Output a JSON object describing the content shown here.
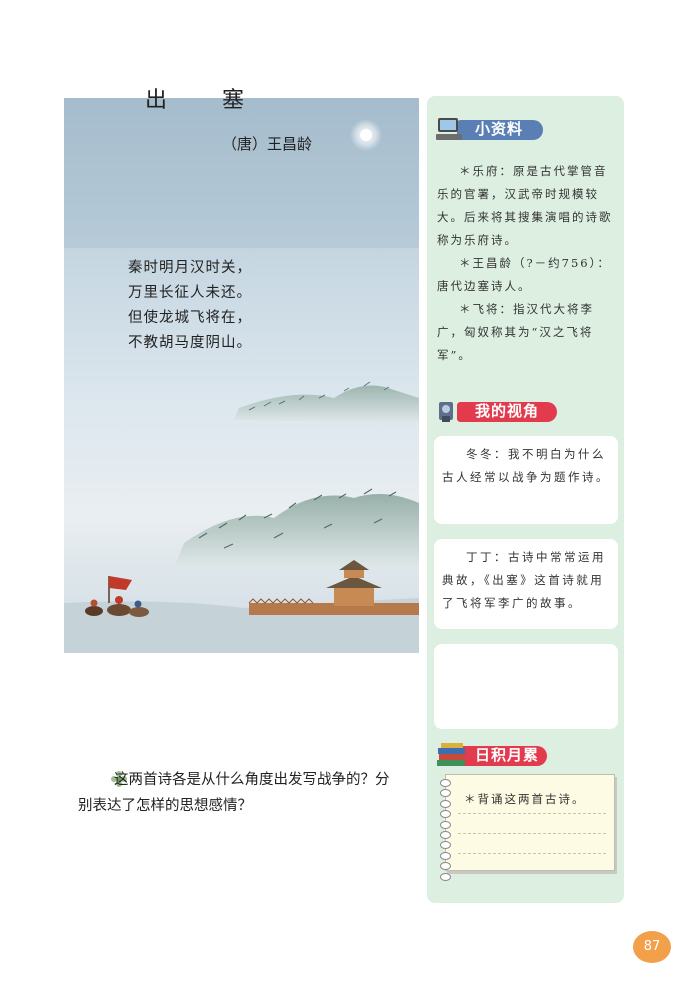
{
  "poem": {
    "title": "出 塞",
    "author": "（唐）王昌龄",
    "lines": [
      "秦时明月汉时关，",
      "万里长征人未还。",
      "但使龙城飞将在，",
      "不教胡马度阴山。"
    ]
  },
  "question": {
    "text": "这两首诗各是从什么角度出发写战争的？分别表达了怎样的思想感情？",
    "icon": "flower-icon"
  },
  "sidebar": {
    "resources": {
      "title": "小资料",
      "icon": "computer-icon",
      "paragraphs": [
        "＊乐府：原是古代掌管音乐的官署，汉武帝时规模较大。后来将其搜集演唱的诗歌称为乐府诗。",
        "＊王昌龄（?－约756）：唐代边塞诗人。",
        "＊飞将：指汉代大将李广，匈奴称其为“汉之飞将军”。"
      ]
    },
    "views": {
      "title": "我的视角",
      "icon": "camera-icon",
      "comments": [
        "冬冬：我不明白为什么古人经常以战争为题作诗。",
        "丁丁：古诗中常常运用典故，《出塞》这首诗就用了飞将军李广的故事。",
        ""
      ]
    },
    "daily": {
      "title": "日积月累",
      "icon": "books-icon",
      "task": "＊背诵这两首古诗。"
    }
  },
  "page_number": "87",
  "colors": {
    "sidebar_bg": "#dcefe1",
    "resources_label": "#5a7fb4",
    "views_label": "#e23b4d",
    "daily_label": "#e23b4d",
    "page_badge": "#f3a04a"
  }
}
